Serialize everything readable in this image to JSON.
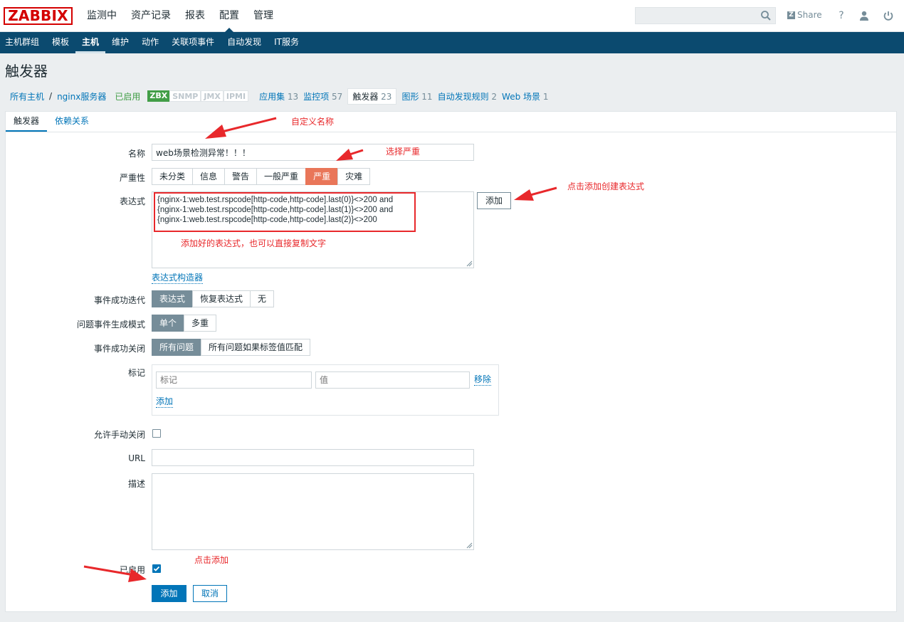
{
  "brand": "ZABBIX",
  "topnav": [
    {
      "label": "监测中"
    },
    {
      "label": "资产记录"
    },
    {
      "label": "报表"
    },
    {
      "label": "配置",
      "active": true
    },
    {
      "label": "管理"
    }
  ],
  "search": {
    "placeholder": ""
  },
  "share": "Share",
  "help": "?",
  "subnav": [
    {
      "label": "主机群组"
    },
    {
      "label": "模板"
    },
    {
      "label": "主机",
      "active": true
    },
    {
      "label": "维护"
    },
    {
      "label": "动作"
    },
    {
      "label": "关联项事件"
    },
    {
      "label": "自动发现"
    },
    {
      "label": "IT服务"
    }
  ],
  "page_title": "触发器",
  "breadcrumbs": {
    "all_hosts": "所有主机",
    "sep": "/",
    "host": "nginx服务器",
    "enabled": "已启用",
    "availability": {
      "zbx": "ZBX",
      "snmp": "SNMP",
      "jmx": "JMX",
      "ipmi": "IPMI"
    },
    "apps": {
      "label": "应用集",
      "count": "13"
    },
    "items": {
      "label": "监控项",
      "count": "57"
    },
    "triggers": {
      "label": "触发器",
      "count": "23"
    },
    "graphs": {
      "label": "图形",
      "count": "11"
    },
    "discovery": {
      "label": "自动发现规则",
      "count": "2"
    },
    "web": {
      "label": "Web 场景",
      "count": "1"
    }
  },
  "tabs": [
    {
      "label": "触发器",
      "active": true
    },
    {
      "label": "依赖关系"
    }
  ],
  "form": {
    "name_label": "名称",
    "name_value": "web场景检测异常！！！",
    "severity_label": "严重性",
    "severity_options": [
      "未分类",
      "信息",
      "警告",
      "一般严重",
      "严重",
      "灾难"
    ],
    "severity_selected": "严重",
    "expression_label": "表达式",
    "expression_lines": [
      "{nginx-1:web.test.rspcode[http-code,http-code].last(0)}<>200 and",
      "{nginx-1:web.test.rspcode[http-code,http-code].last(1)}<>200 and",
      "{nginx-1:web.test.rspcode[http-code,http-code].last(2)}<>200"
    ],
    "expression_add": "添加",
    "expression_builder": "表达式构造器",
    "ok_event_label": "事件成功迭代",
    "ok_event_options": [
      "表达式",
      "恢复表达式",
      "无"
    ],
    "gen_mode_label": "问题事件生成模式",
    "gen_mode_options": [
      "单个",
      "多重"
    ],
    "ok_close_label": "事件成功关闭",
    "ok_close_options": [
      "所有问题",
      "所有问题如果标签值匹配"
    ],
    "tags_label": "标记",
    "tag_placeholder": "标记",
    "value_placeholder": "值",
    "tag_remove": "移除",
    "tag_add": "添加",
    "manual_close_label": "允许手动关闭",
    "url_label": "URL",
    "desc_label": "描述",
    "enabled_label": "已启用",
    "submit": "添加",
    "cancel": "取消"
  },
  "annotations": {
    "custom_name": "自定义名称",
    "choose_severity": "选择严重",
    "click_add_expr": "点击添加创建表达式",
    "expr_note": "添加好的表达式，也可以直接复制文字",
    "click_add": "点击添加"
  },
  "colors": {
    "nav_bg": "#0b4a6f",
    "accent": "#0275b8",
    "severity": "#e97659",
    "annotation": "#e8282b",
    "enabled": "#429e47"
  }
}
